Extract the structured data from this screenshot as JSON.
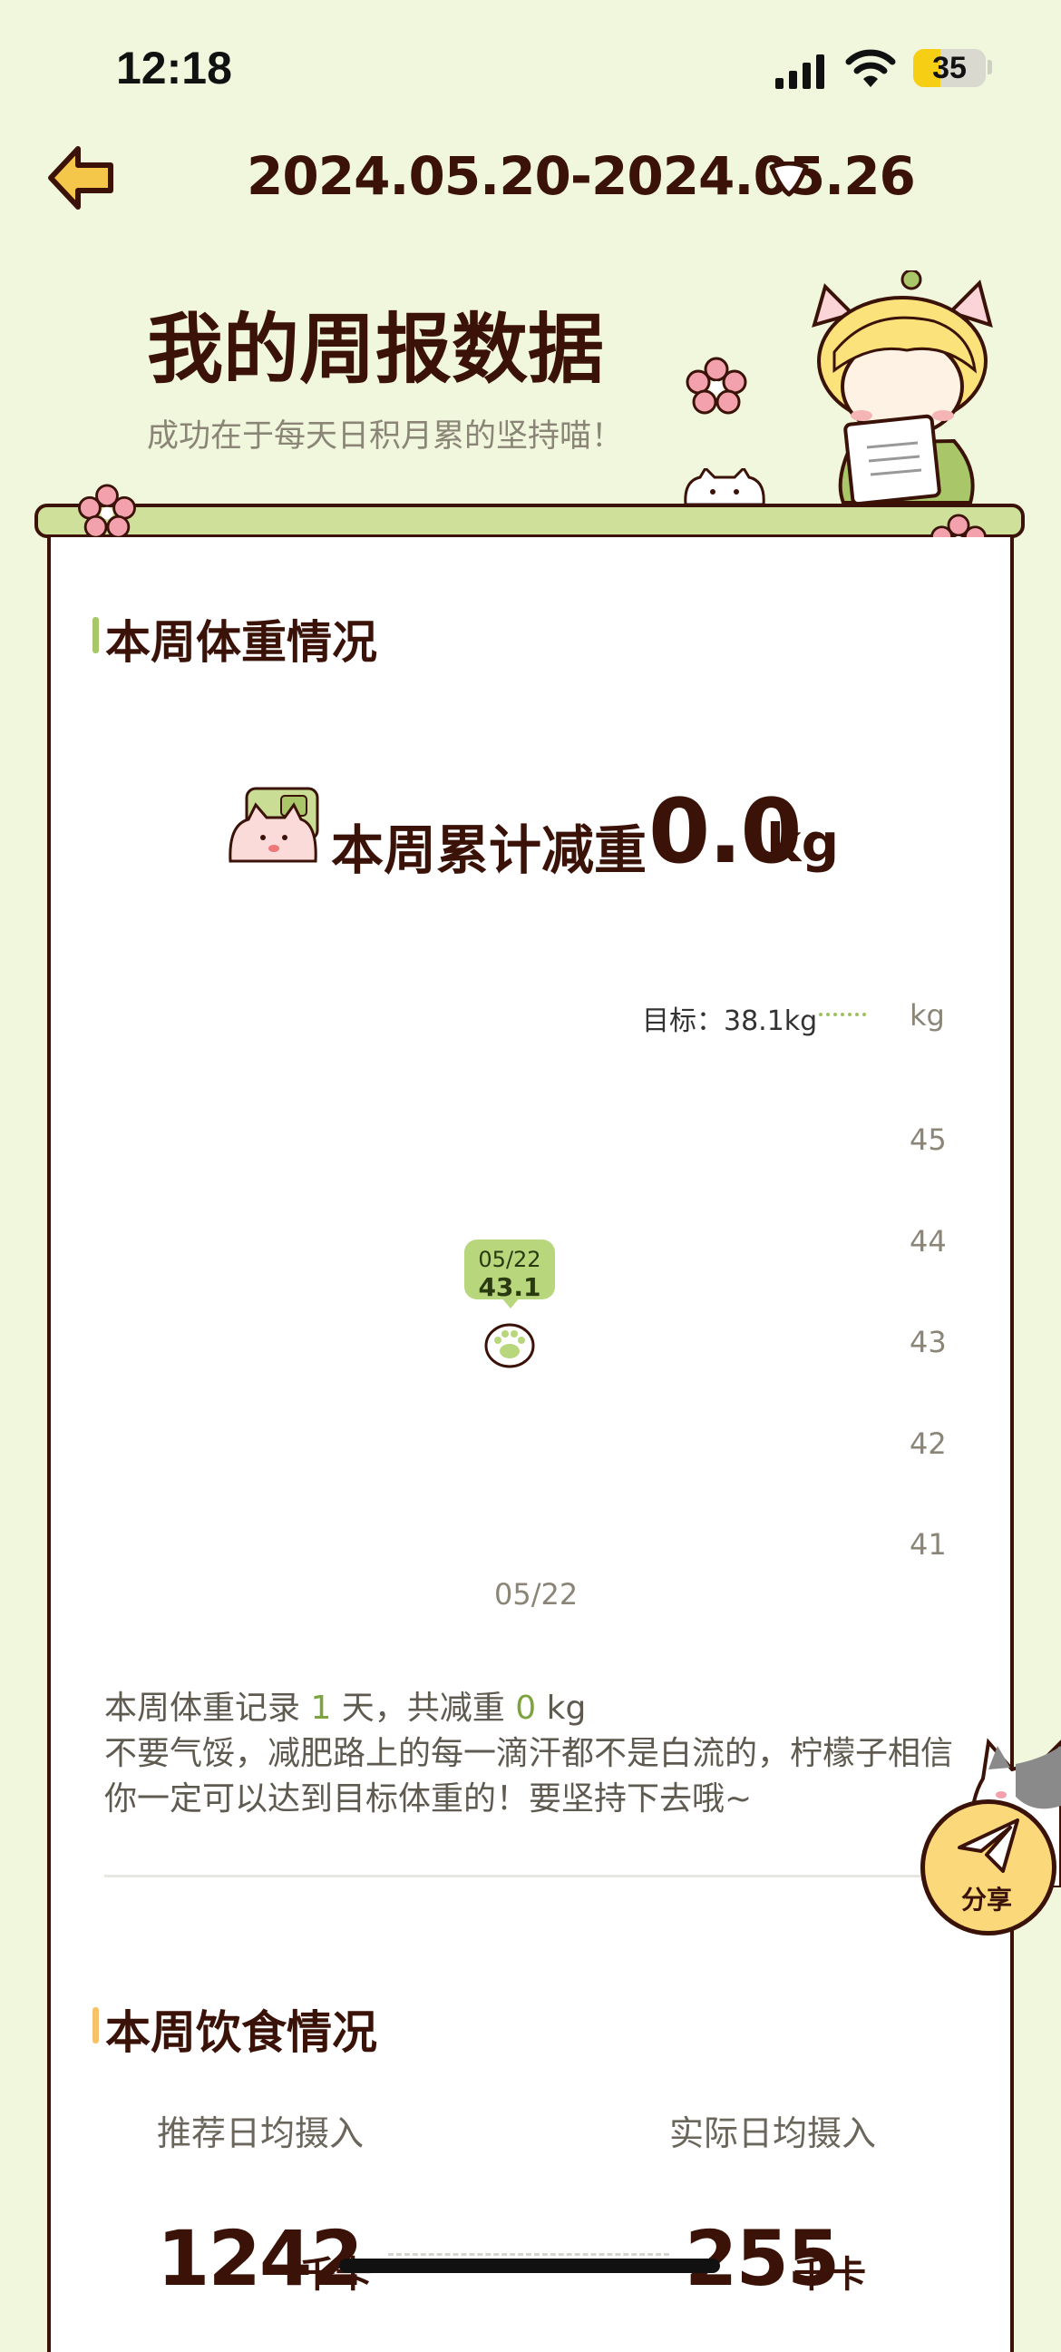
{
  "status_bar": {
    "time": "12:18",
    "battery": "35"
  },
  "header": {
    "date_range": "2024.05.20-2024.05.26"
  },
  "page": {
    "title": "我的周报数据",
    "subtitle": "成功在于每天日积月累的坚持喵！"
  },
  "weight_section": {
    "title": "本周体重情况",
    "loss_label": "本周累计减重",
    "loss_value": "0.0",
    "loss_unit": "kg",
    "goal_text": "目标：38.1kg",
    "unit": "kg",
    "summary_prefix": "本周体重记录 ",
    "days": "1",
    "summary_mid": " 天，共减重 ",
    "loss_amount": "0",
    "summary_suffix": " kg",
    "encouragement": "不要气馁，减肥路上的每一滴汗都不是白流的，柠檬子相信你一定可以达到目标体重的！要坚持下去哦~"
  },
  "chart_data": {
    "type": "scatter",
    "x": [
      "05/22"
    ],
    "y": [
      43.1
    ],
    "ylim": [
      41,
      45
    ],
    "yticks": [
      "45",
      "44",
      "43",
      "42",
      "41"
    ],
    "tooltip": {
      "date": "05/22",
      "value": "43.1"
    },
    "goal_line": 38.1,
    "grid": false
  },
  "diet_section": {
    "title": "本周饮食情况",
    "recommended_label": "推荐日均摄入",
    "actual_label": "实际日均摄入",
    "recommended_value": "1242",
    "actual_value": "255",
    "unit": "千卡"
  },
  "share": {
    "label": "分享"
  },
  "colors": {
    "background": "#f1f7dd",
    "text_dark": "#3a1208",
    "accent_green": "#b8d67c",
    "accent_yellow": "#fbd97a"
  }
}
